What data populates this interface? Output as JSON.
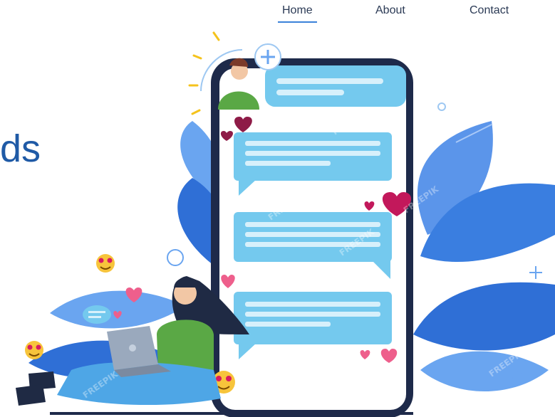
{
  "nav": {
    "items": [
      {
        "label": "Home",
        "active": true
      },
      {
        "label": "About",
        "active": false
      },
      {
        "label": "Contact",
        "active": false
      }
    ]
  },
  "hero": {
    "partial_heading": "ds"
  },
  "illustration": {
    "watermark": "FREEPIK",
    "colors": {
      "phone_frame": "#1e2a4a",
      "screen": "#ffffff",
      "bubble": "#74c9ee",
      "bubble_lines": "#d7f0fb",
      "leaf_dark": "#2f6fd6",
      "leaf_light": "#6aa5f0",
      "heart": "#c2185b",
      "heart_pink": "#ee5f8c",
      "shirt": "#5aa845",
      "hair": "#1f2a44"
    }
  }
}
